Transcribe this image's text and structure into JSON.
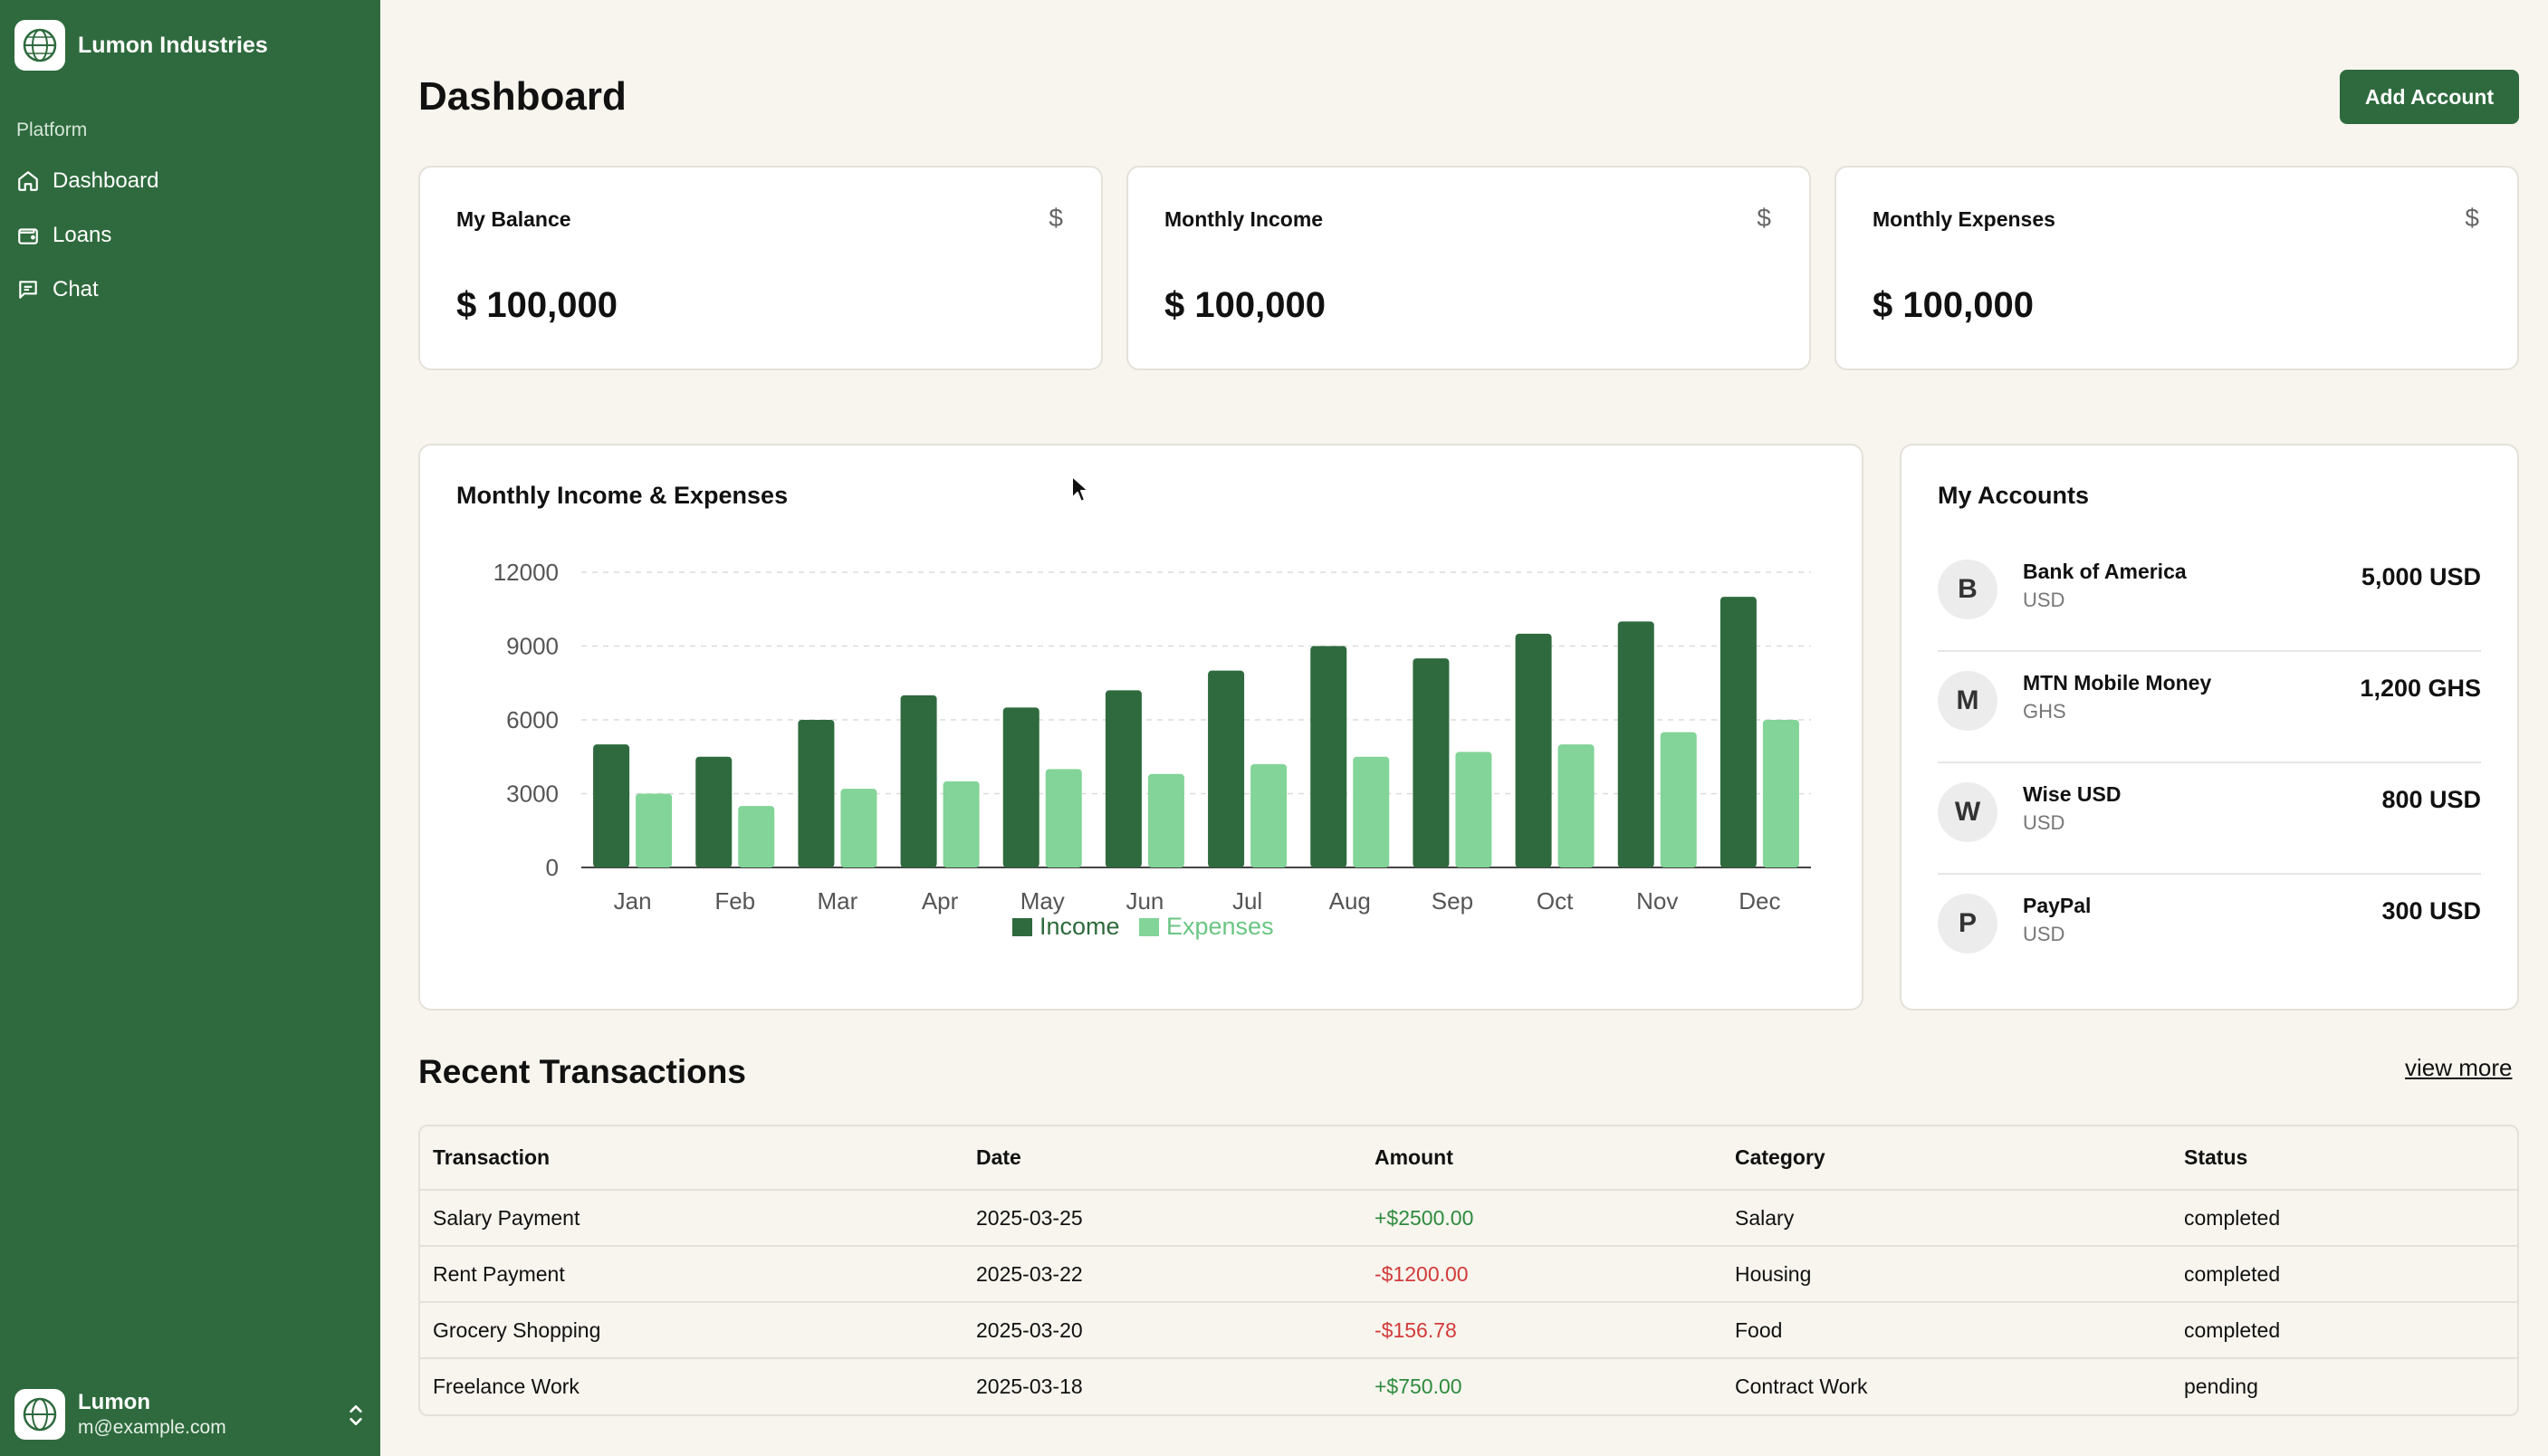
{
  "sidebar": {
    "brand": "Lumon Industries",
    "section": "Platform",
    "items": [
      {
        "label": "Dashboard",
        "icon": "home-icon"
      },
      {
        "label": "Loans",
        "icon": "wallet-icon"
      },
      {
        "label": "Chat",
        "icon": "chat-icon"
      }
    ],
    "user": {
      "name": "Lumon",
      "email": "m@example.com"
    }
  },
  "header": {
    "title": "Dashboard",
    "add_button": "Add Account"
  },
  "stats": [
    {
      "label": "My Balance",
      "icon": "$",
      "value": "$ 100,000"
    },
    {
      "label": "Monthly Income",
      "icon": "$",
      "value": "$ 100,000"
    },
    {
      "label": "Monthly Expenses",
      "icon": "$",
      "value": "$ 100,000"
    }
  ],
  "chart_card": {
    "title": "Monthly Income & Expenses"
  },
  "chart_data": {
    "type": "bar",
    "categories": [
      "Jan",
      "Feb",
      "Mar",
      "Apr",
      "May",
      "Jun",
      "Jul",
      "Aug",
      "Sep",
      "Oct",
      "Nov",
      "Dec"
    ],
    "series": [
      {
        "name": "Income",
        "color": "#2e6a3d",
        "values": [
          5000,
          4500,
          6000,
          7000,
          6500,
          7200,
          8000,
          9000,
          8500,
          9500,
          10000,
          11000
        ]
      },
      {
        "name": "Expenses",
        "color": "#82d498",
        "values": [
          3000,
          2500,
          3200,
          3500,
          4000,
          3800,
          4200,
          4500,
          4700,
          5000,
          5500,
          6000
        ]
      }
    ],
    "ylim": [
      0,
      12000
    ],
    "yticks": [
      0,
      3000,
      6000,
      9000,
      12000
    ],
    "grid": true,
    "legend": "bottom"
  },
  "accounts": {
    "title": "My Accounts",
    "items": [
      {
        "initial": "B",
        "name": "Bank of America",
        "currency": "USD",
        "amount": "5,000 USD"
      },
      {
        "initial": "M",
        "name": "MTN Mobile Money",
        "currency": "GHS",
        "amount": "1,200 GHS"
      },
      {
        "initial": "W",
        "name": "Wise USD",
        "currency": "USD",
        "amount": "800 USD"
      },
      {
        "initial": "P",
        "name": "PayPal",
        "currency": "USD",
        "amount": "300 USD"
      }
    ]
  },
  "transactions": {
    "title": "Recent Transactions",
    "view_more": "view more",
    "columns": [
      "Transaction",
      "Date",
      "Amount",
      "Category",
      "Status"
    ],
    "rows": [
      {
        "name": "Salary Payment",
        "date": "2025-03-25",
        "amount": "+$2500.00",
        "category": "Salary",
        "status": "completed"
      },
      {
        "name": "Rent Payment",
        "date": "2025-03-22",
        "amount": "-$1200.00",
        "category": "Housing",
        "status": "completed"
      },
      {
        "name": "Grocery Shopping",
        "date": "2025-03-20",
        "amount": "-$156.78",
        "category": "Food",
        "status": "completed"
      },
      {
        "name": "Freelance Work",
        "date": "2025-03-18",
        "amount": "+$750.00",
        "category": "Contract Work",
        "status": "pending"
      }
    ]
  }
}
